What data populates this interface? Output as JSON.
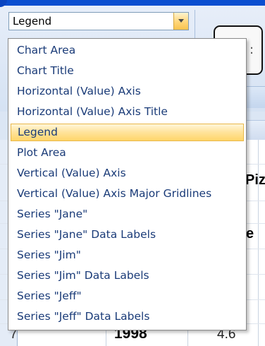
{
  "format_selector": {
    "current_value": "Legend",
    "options": [
      "Chart Area",
      "Chart Title",
      "Horizontal (Value) Axis",
      "Horizontal (Value) Axis Title",
      "Legend",
      "Plot Area",
      "Vertical (Value) Axis",
      "Vertical (Value) Axis Major Gridlines",
      "Series \"Jane\"",
      "Series \"Jane\" Data Labels",
      "Series \"Jim\"",
      "Series \"Jim\" Data Labels",
      "Series \"Jeff\"",
      "Series \"Jeff\" Data Labels"
    ],
    "selected_option": "Legend"
  },
  "background_sheet": {
    "header_fragment": "Piz",
    "fragment_letter": "e",
    "row_number": "7",
    "year": "1998",
    "value": "4.6"
  },
  "colors": {
    "item_text": "#1a3b78",
    "highlight": "#ffe39a",
    "accent_blue": "#0b4fd0"
  }
}
